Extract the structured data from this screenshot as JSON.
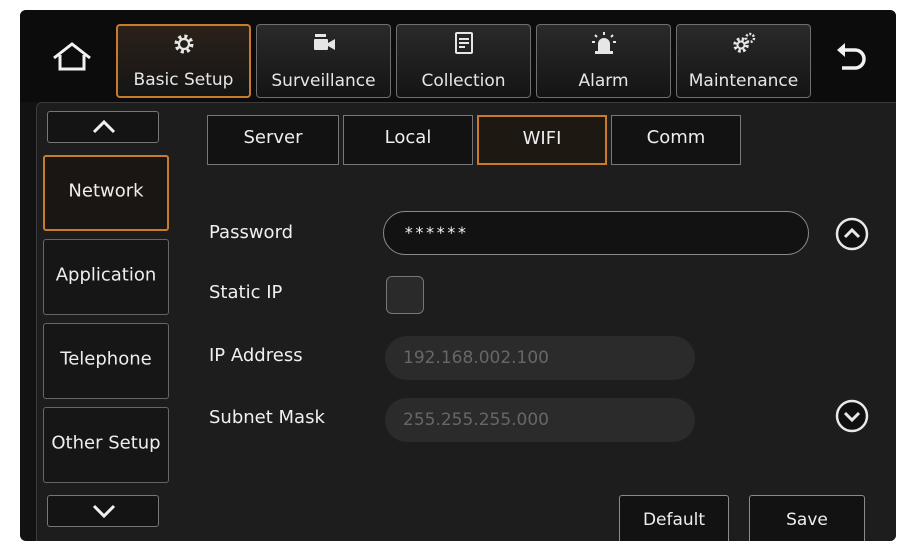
{
  "topbar": {
    "home_icon": "home-icon",
    "back_icon": "back-arrow-icon",
    "tabs": [
      {
        "label": "Basic Setup",
        "icon": "gear-icon",
        "active": true
      },
      {
        "label": "Surveillance",
        "icon": "camera-icon",
        "active": false
      },
      {
        "label": "Collection",
        "icon": "document-icon",
        "active": false
      },
      {
        "label": "Alarm",
        "icon": "siren-icon",
        "active": false
      },
      {
        "label": "Maintenance",
        "icon": "gears-icon",
        "active": false
      }
    ]
  },
  "sidebar": {
    "items": [
      {
        "label": "Network",
        "active": true
      },
      {
        "label": "Application",
        "active": false
      },
      {
        "label": "Telephone",
        "active": false
      },
      {
        "label": "Other Setup",
        "active": false
      }
    ]
  },
  "subtabs": [
    {
      "label": "Server",
      "active": false
    },
    {
      "label": "Local",
      "active": false
    },
    {
      "label": "WIFI",
      "active": true
    },
    {
      "label": "Comm",
      "active": false
    }
  ],
  "form": {
    "password_label": "Password",
    "password_value": "******",
    "static_ip_label": "Static IP",
    "static_ip_checked": false,
    "ip_label": "IP Address",
    "ip_value": "192.168.002.100",
    "mask_label": "Subnet Mask",
    "mask_value": "255.255.255.000"
  },
  "buttons": {
    "default_label": "Default",
    "save_label": "Save"
  },
  "colors": {
    "accent": "#c97a2a",
    "background": "#121212",
    "panel": "#1d1d1d"
  }
}
